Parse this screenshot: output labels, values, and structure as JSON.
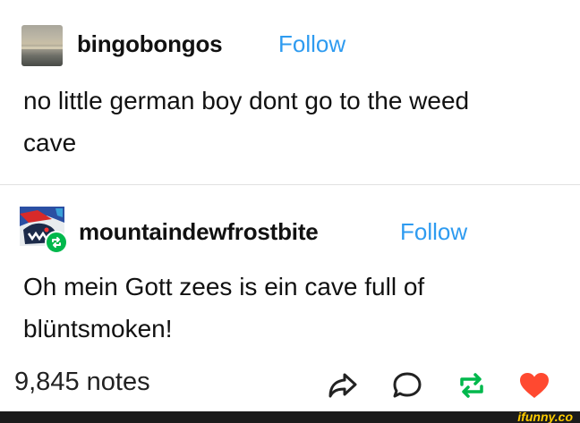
{
  "post1": {
    "username": "bingobongos",
    "follow_label": "Follow",
    "text_line1": "no little german boy dont go to the weed",
    "text_line2": "cave",
    "avatar_icon": "sunset-avatar"
  },
  "post2": {
    "username": "mountaindewfrostbite",
    "follow_label": "Follow",
    "text_line1": "Oh mein Gott zees is ein cave full of",
    "text_line2": "blüntsmoken!",
    "avatar_icon": "mountain-dew-avatar",
    "badge_icon": "reblog-badge-icon"
  },
  "footer": {
    "notes": "9,845 notes",
    "actions": [
      "share-icon",
      "reply-icon",
      "reblog-icon",
      "like-icon"
    ]
  },
  "watermark": {
    "text": "ifunny.co"
  },
  "colors": {
    "follow": "#2e9bf0",
    "reblog": "#00b84c",
    "like": "#ff4930",
    "watermark": "#ffcc00"
  }
}
